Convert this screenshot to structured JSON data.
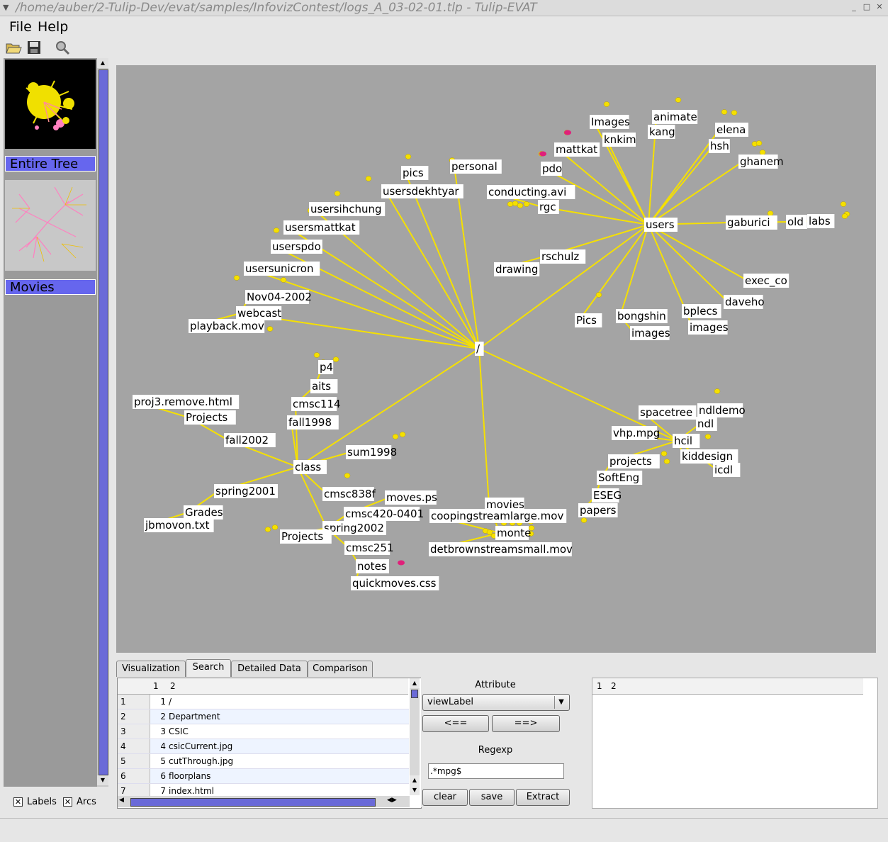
{
  "window": {
    "title": "/home/auber/2-Tulip-Dev/evat/samples/InfovizContest/logs_A_03-02-01.tlp - Tulip-EVAT"
  },
  "menubar": {
    "file": "File",
    "help": "Help"
  },
  "toolbar": {
    "icons": [
      "open-folder-icon",
      "save-icon",
      "magnifier-icon"
    ]
  },
  "left_panel": {
    "views": [
      {
        "label": "Entire Tree"
      },
      {
        "label": "Movies"
      }
    ],
    "checkboxes": [
      {
        "label": "Labels",
        "checked": true
      },
      {
        "label": "Arcs",
        "checked": true
      }
    ]
  },
  "graph": {
    "root": "/",
    "labels": {
      "images1": "Images",
      "animate": "animate",
      "elena": "elena",
      "knkim": "knkim",
      "kang": "kang",
      "hsh": "hsh",
      "mattkat": "mattkat",
      "ghanem": "ghanem",
      "pics": "pics",
      "personal": "personal",
      "pdo": "pdo",
      "usersdekhtyar": "usersdekhtyar",
      "conducting": "conducting.avi",
      "usersihchung": "usersihchung",
      "rgc": "rgc",
      "users": "users",
      "gaburici": "gaburici",
      "old": "old",
      "labs": "labs",
      "usersmattkat": "usersmattkat",
      "userspdo": "userspdo",
      "rschulz": "rschulz",
      "drawing": "drawing",
      "usersunicron": "usersunicron",
      "exec_co": "exec_co",
      "daveho": "daveho",
      "nov04": "Nov04-2002",
      "bplecs": "bplecs",
      "bongshin": "bongshin",
      "webcast": "webcast",
      "pics2": "Pics",
      "playback": "playback.mov",
      "images2": "images",
      "images3": "images",
      "p4": "p4",
      "aits": "aits",
      "cmsc114": "cmsc114",
      "proj3": "proj3.remove.html",
      "projects1": "Projects",
      "fall1998": "fall1998",
      "spacetree": "spacetree",
      "ndldemo": "ndldemo",
      "ndl": "ndl",
      "fall2002": "fall2002",
      "vhp": "vhp.mpg",
      "hcil": "hcil",
      "sum1998": "sum1998",
      "kiddesign": "kiddesign",
      "projects2": "projects",
      "class": "class",
      "icdl": "icdl",
      "softeng": "SoftEng",
      "spring2001a": "spring2001",
      "cmsc838f": "cmsc838f",
      "eseg": "ESEG",
      "movesps": "moves.ps",
      "movies": "movies",
      "papers": "papers",
      "grades": "Grades",
      "cmsc420": "cmsc420-0401",
      "cooping": "coopingstreamlarge.mov",
      "jbmovon": "jbmovon.txt",
      "spring2002": "spring2002",
      "monte": "monte",
      "projects3": "Projects",
      "cmsc251": "cmsc251",
      "detbrown": "detbrownstreamsmall.mov",
      "notes": "notes",
      "quickmoves": "quickmoves.css"
    }
  },
  "tabs": [
    {
      "label": "Visualization",
      "active": false
    },
    {
      "label": "Search",
      "active": true
    },
    {
      "label": "Detailed Data",
      "active": false
    },
    {
      "label": "Comparison",
      "active": false
    }
  ],
  "search_table": {
    "headers": [
      "1",
      "2"
    ],
    "rows": [
      {
        "row": "1",
        "id": "1",
        "name": "/"
      },
      {
        "row": "2",
        "id": "2",
        "name": "Department"
      },
      {
        "row": "3",
        "id": "3",
        "name": "CSIC"
      },
      {
        "row": "4",
        "id": "4",
        "name": "csicCurrent.jpg"
      },
      {
        "row": "5",
        "id": "5",
        "name": "cutThrough.jpg"
      },
      {
        "row": "6",
        "id": "6",
        "name": "floorplans"
      },
      {
        "row": "7",
        "id": "7",
        "name": "index.html"
      }
    ]
  },
  "search_controls": {
    "attribute_label": "Attribute",
    "attribute_value": "viewLabel",
    "left_button": "<==",
    "right_button": "==>",
    "regexp_label": "Regexp",
    "regexp_value": ".*mpg$",
    "clear": "clear",
    "save": "save",
    "extract": "Extract"
  },
  "result_table": {
    "headers": [
      "1",
      "2"
    ]
  },
  "colors": {
    "edge": "#f5e000",
    "node": "#f5e000",
    "highlight": "#e0207a",
    "canvas_bg": "#a4a4a4",
    "view_label_bg": "#6666ee"
  }
}
